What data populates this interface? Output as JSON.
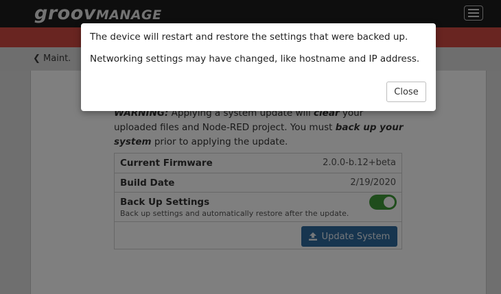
{
  "navbar": {
    "logo_groov": "groov",
    "logo_manage": "MANAGE"
  },
  "subheader": {
    "back_label": "Maint."
  },
  "content": {
    "warning_prefix": "WARNING:",
    "warning_text_1": " Applying a system update will ",
    "warning_clear": "clear",
    "warning_text_2": " your uploaded files and Node-RED project. You must ",
    "warning_backup": "back up your system",
    "warning_text_3": " prior to applying the update."
  },
  "table": {
    "rows": [
      {
        "label": "Current Firmware",
        "value": "2.0.0-b.12+beta"
      },
      {
        "label": "Build Date",
        "value": "2/19/2020"
      }
    ],
    "backup_label": "Back Up Settings",
    "backup_desc": "Back up settings and automatically restore after the update.",
    "backup_enabled": true,
    "update_button": "Update System"
  },
  "modal": {
    "line1": "The device will restart and restore the settings that were backed up.",
    "line2": "Networking settings may have changed, like hostname and IP address.",
    "close_label": "Close"
  },
  "colors": {
    "navbar": "#1c1c1c",
    "accent_red": "#d24a42",
    "toggle_green": "#3e9a38",
    "button_blue": "#2e6a9e"
  }
}
